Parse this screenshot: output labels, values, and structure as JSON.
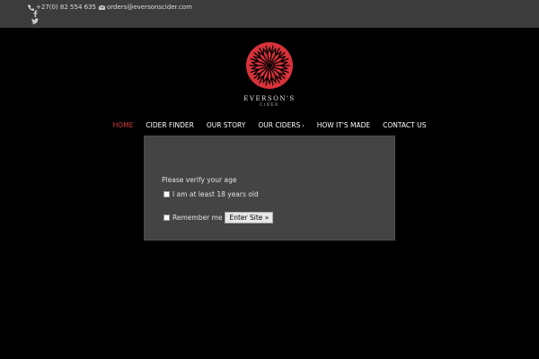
{
  "topbar": {
    "phone": "+27(0) 82 554 635",
    "email": "orders@eversonscider.com",
    "social_icons": [
      "facebook-icon",
      "twitter-icon"
    ]
  },
  "logo": {
    "brand": "EVERSON'S",
    "sub": "CIDER"
  },
  "nav": {
    "items": [
      {
        "label": "HOME",
        "active": true
      },
      {
        "label": "CIDER FINDER"
      },
      {
        "label": "OUR STORY"
      },
      {
        "label": "OUR CIDERS",
        "has_dropdown": true
      },
      {
        "label": "HOW IT'S MADE"
      },
      {
        "label": "CONTACT US"
      }
    ]
  },
  "age_gate": {
    "prompt": "Please verify your age",
    "age_checkbox_label": "I am at least 18 years old",
    "remember_label": "Remember me",
    "enter_button": "Enter Site »"
  },
  "colors": {
    "topbar_bg": "#3c3c3c",
    "page_bg": "#000000",
    "nav_active": "#d63a3a",
    "logo_red": "#d8323a",
    "modal_bg": "#444444"
  }
}
